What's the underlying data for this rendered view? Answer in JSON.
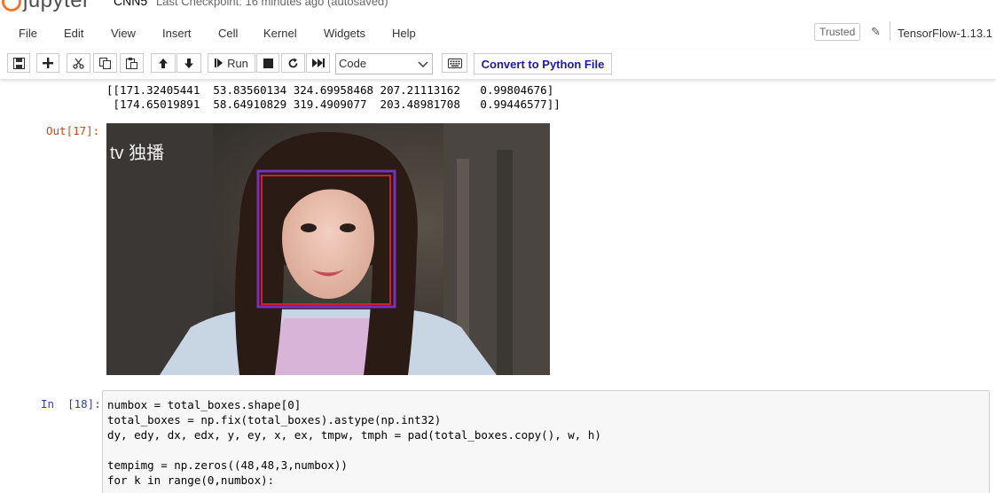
{
  "header": {
    "logo_text": "jupyter",
    "notebook_name": "CNN5",
    "status": "Last Checkpoint: 16 minutes ago  (autosaved)"
  },
  "menu": {
    "items": [
      "File",
      "Edit",
      "View",
      "Insert",
      "Cell",
      "Kernel",
      "Widgets",
      "Help"
    ],
    "trusted": "Trusted",
    "kernel": "TensorFlow-1.13.1"
  },
  "toolbar": {
    "run_label": "Run",
    "cell_type": "Code",
    "convert_label": "Convert to Python File",
    "icons": [
      "save-icon",
      "plus-icon",
      "scissors-icon",
      "copy-icon",
      "paste-icon",
      "arrow-up-icon",
      "arrow-down-icon",
      "step-forward-icon",
      "stop-icon",
      "restart-icon",
      "fast-forward-icon",
      "keyboard-icon"
    ]
  },
  "output": {
    "lines": [
      "[[171.32405441  53.83560134 324.69958468 207.21113162   0.99804676]",
      " [174.65019891  58.64910829 319.4909077  203.48981708   0.99446577]]"
    ],
    "prompt": "Out[17]:",
    "image_watermark": "tv 独播"
  },
  "cell": {
    "prompt": "In  [18]:",
    "lines": [
      "numbox = total_boxes.shape[0]",
      "total_boxes = np.fix(total_boxes).astype(np.int32)",
      "dy, edy, dx, edx, y, ey, x, ex, tmpw, tmph = pad(total_boxes.copy(), w, h)",
      "",
      "tempimg = np.zeros((48,48,3,numbox))",
      "for k in range(0,numbox):"
    ]
  },
  "colors": {
    "box_purple": "#7b2fbf",
    "box_red": "#d2202a",
    "prompt_in": "#303f9f",
    "prompt_out": "#d84315",
    "link_blue": "#1a1aa6"
  }
}
